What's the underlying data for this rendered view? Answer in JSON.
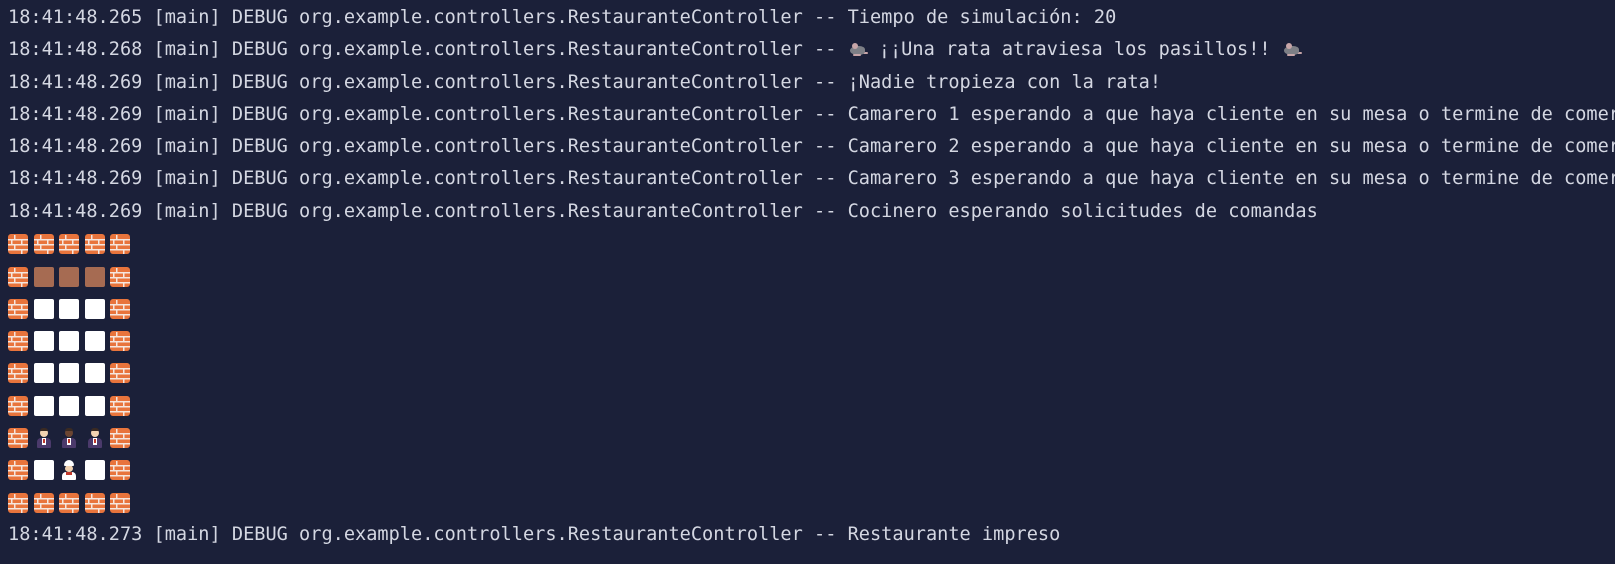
{
  "console": {
    "log_lines_top": [
      {
        "prefix": "18:41:48.265 [main] DEBUG org.example.controllers.RestauranteController -- ",
        "message": "Tiempo de simulación: 20"
      },
      {
        "prefix": "18:41:48.268 [main] DEBUG org.example.controllers.RestauranteController -- ",
        "message": " ¡¡Una rata atraviesa los pasillos!! ",
        "rat_icons": true
      },
      {
        "prefix": "18:41:48.269 [main] DEBUG org.example.controllers.RestauranteController -- ",
        "message": "¡Nadie tropieza con la rata!"
      },
      {
        "prefix": "18:41:48.269 [main] DEBUG org.example.controllers.RestauranteController -- ",
        "message": "Camarero 1 esperando a que haya cliente en su mesa o termine de comer"
      },
      {
        "prefix": "18:41:48.269 [main] DEBUG org.example.controllers.RestauranteController -- ",
        "message": "Camarero 2 esperando a que haya cliente en su mesa o termine de comer"
      },
      {
        "prefix": "18:41:48.269 [main] DEBUG org.example.controllers.RestauranteController -- ",
        "message": "Camarero 3 esperando a que haya cliente en su mesa o termine de comer"
      },
      {
        "prefix": "18:41:48.269 [main] DEBUG org.example.controllers.RestauranteController -- ",
        "message": "Cocinero esperando solicitudes de comandas"
      }
    ],
    "restaurant_grid": [
      [
        "brick-icon",
        "brick-icon",
        "brick-icon",
        "brick-icon",
        "brick-icon"
      ],
      [
        "brick-icon",
        "brown-square-icon",
        "brown-square-icon",
        "brown-square-icon",
        "brick-icon"
      ],
      [
        "brick-icon",
        "white-square-icon",
        "white-square-icon",
        "white-square-icon",
        "brick-icon"
      ],
      [
        "brick-icon",
        "white-square-icon",
        "white-square-icon",
        "white-square-icon",
        "brick-icon"
      ],
      [
        "brick-icon",
        "white-square-icon",
        "white-square-icon",
        "white-square-icon",
        "brick-icon"
      ],
      [
        "brick-icon",
        "white-square-icon",
        "white-square-icon",
        "white-square-icon",
        "brick-icon"
      ],
      [
        "brick-icon",
        "waiter-icon",
        "waiter-dark-icon",
        "waiter-icon",
        "brick-icon"
      ],
      [
        "brick-icon",
        "white-square-icon",
        "cook-icon",
        "white-square-icon",
        "brick-icon"
      ],
      [
        "brick-icon",
        "brick-icon",
        "brick-icon",
        "brick-icon",
        "brick-icon"
      ]
    ],
    "log_lines_bottom": [
      {
        "prefix": "18:41:48.273 [main] DEBUG org.example.controllers.RestauranteController -- ",
        "message": "Restaurante impreso"
      }
    ]
  },
  "colors": {
    "background": "#1b2039",
    "text": "#d4d7e2"
  }
}
